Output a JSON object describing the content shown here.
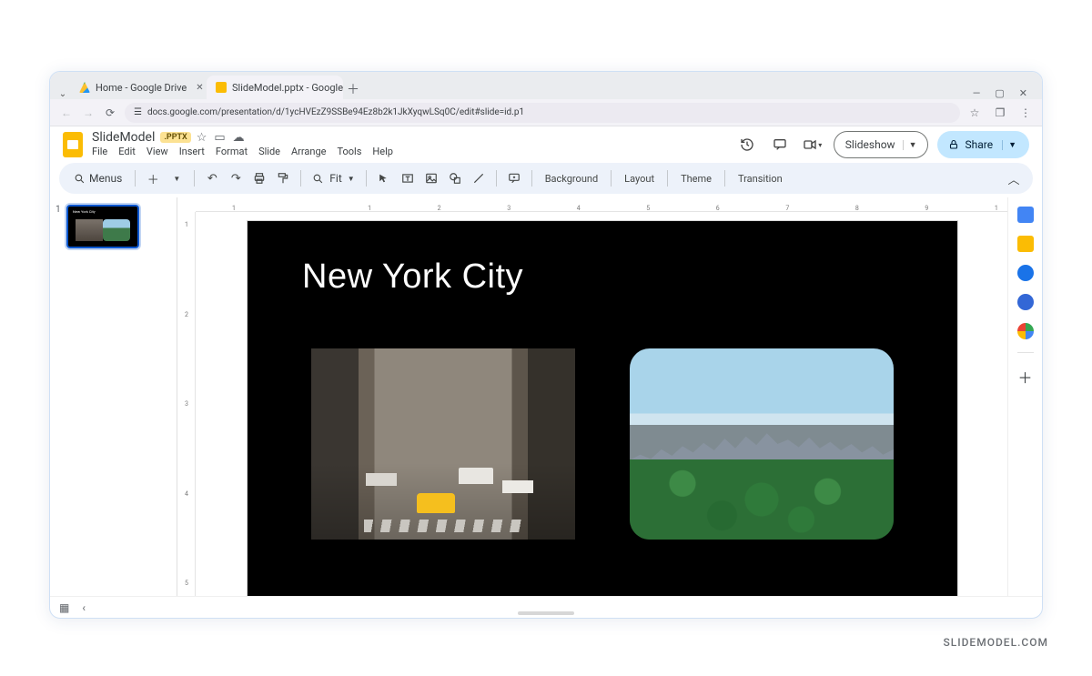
{
  "browser": {
    "tabs": [
      {
        "title": "Home - Google Drive"
      },
      {
        "title": "SlideModel.pptx - Google Slides"
      }
    ],
    "url": "docs.google.com/presentation/d/1ycHVEzZ9SSBe94Ez8b2k1JkXyqwLSq0C/edit#slide=id.p1"
  },
  "app": {
    "doc_title": "SlideModel",
    "format_badge": ".PPTX",
    "menus": [
      "File",
      "Edit",
      "View",
      "Insert",
      "Format",
      "Slide",
      "Arrange",
      "Tools",
      "Help"
    ],
    "slideshow_label": "Slideshow",
    "share_label": "Share"
  },
  "toolbar": {
    "search_label": "Menus",
    "zoom_label": "Fit",
    "buttons": {
      "background": "Background",
      "layout": "Layout",
      "theme": "Theme",
      "transition": "Transition"
    }
  },
  "ruler": {
    "h": [
      "1",
      "",
      "1",
      "2",
      "3",
      "4",
      "5",
      "6",
      "7",
      "8",
      "9",
      "1"
    ],
    "v": [
      "1",
      "2",
      "3",
      "4",
      "5"
    ]
  },
  "filmstrip": {
    "slides": [
      {
        "number": "1",
        "title": "New York City"
      }
    ]
  },
  "slide": {
    "title": "New York City"
  },
  "watermark": "SLIDEMODEL.COM"
}
